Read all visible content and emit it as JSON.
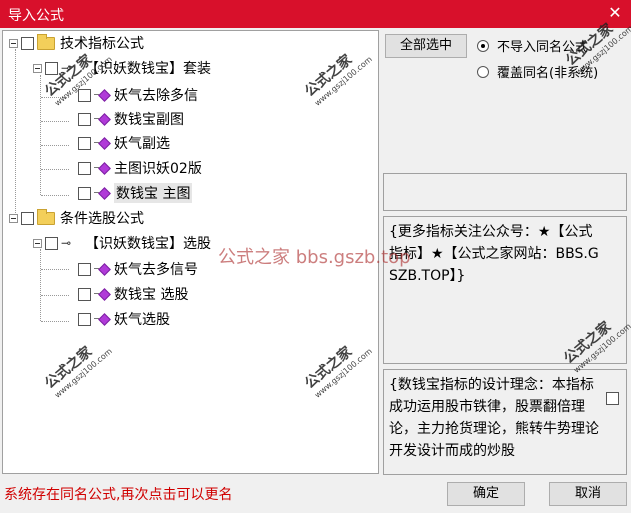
{
  "window": {
    "title": "导入公式",
    "close_glyph": "✕"
  },
  "tree": {
    "groups": [
      {
        "label": "技术指标公式",
        "subgroup": "【识妖数钱宝】套装",
        "items": [
          "妖气去除多信",
          "数钱宝副图",
          "妖气副选",
          "主图识妖02版",
          "数钱宝 主图"
        ]
      },
      {
        "label": "条件选股公式",
        "subgroup": "【识妖数钱宝】选股",
        "items": [
          "妖气去多信号",
          "数钱宝 选股",
          "妖气选股"
        ]
      }
    ]
  },
  "right": {
    "select_all": "全部选中",
    "radio1": "不导入同名公式",
    "radio2": "覆盖同名(非系统)",
    "info_text": "{更多指标关注公众号：★【公式指标】★【公式之家网站：BBS.GSZB.TOP】}",
    "desc_text": "{数钱宝指标的设计理念：本指标成功运用股市铁律，股票翻倍理论，主力抢货理论，熊转牛势理论开发设计而成的炒股"
  },
  "watermark": {
    "text": "公式之家",
    "url": "www.gszj100.com",
    "center": "公式之家 bbs.gszb.top"
  },
  "buttons": {
    "ok": "确定",
    "cancel": "取消"
  },
  "status": "系统存在同名公式,再次点击可以更名"
}
